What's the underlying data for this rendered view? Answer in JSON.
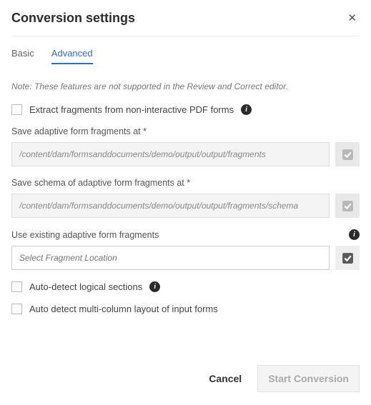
{
  "header": {
    "title": "Conversion settings"
  },
  "tabs": {
    "basic": "Basic",
    "advanced": "Advanced"
  },
  "note": "Note: These features are not supported in the Review and Correct editor.",
  "extract": {
    "label": "Extract fragments from non-interactive PDF forms"
  },
  "saveFragments": {
    "label": "Save adaptive form fragments at *",
    "value": "/content/dam/formsanddocuments/demo/output/output/fragments"
  },
  "saveSchema": {
    "label": "Save schema of adaptive form fragments at *",
    "value": "/content/dam/formsanddocuments/demo/output/output/fragments/schema"
  },
  "useExisting": {
    "label": "Use existing adaptive form fragments",
    "placeholder": "Select Fragment Location"
  },
  "autoDetectSections": {
    "label": "Auto-detect logical sections"
  },
  "autoDetectColumns": {
    "label": "Auto detect multi-column layout of input forms"
  },
  "footer": {
    "cancel": "Cancel",
    "start": "Start Conversion"
  }
}
